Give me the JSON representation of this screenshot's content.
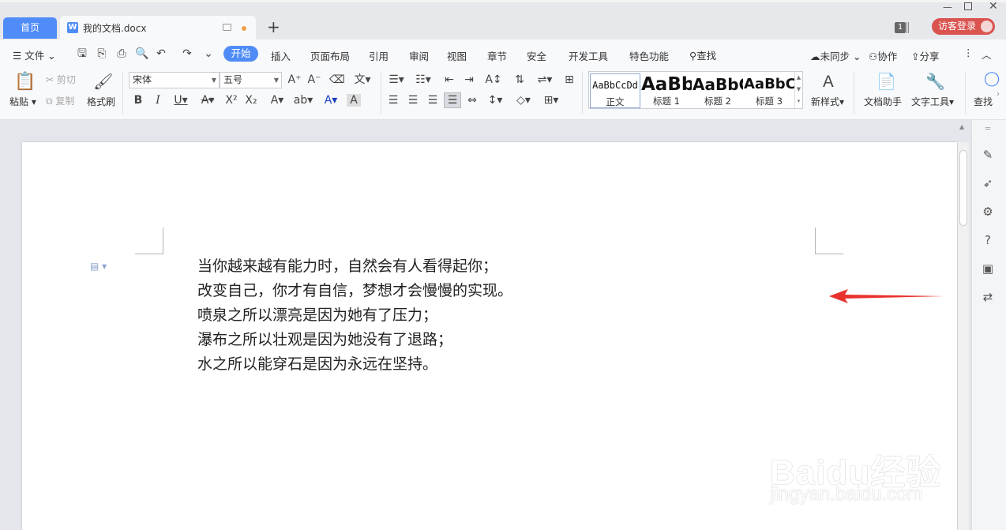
{
  "tabs": {
    "home": "首页",
    "doc": "我的文档.docx",
    "new_tab": "+"
  },
  "titlebar": {
    "badge": "1",
    "login": "访客登录"
  },
  "menu": {
    "file": "文件",
    "items": [
      "开始",
      "插入",
      "页面布局",
      "引用",
      "审阅",
      "视图",
      "章节",
      "安全",
      "开发工具",
      "特色功能"
    ],
    "search": "查找",
    "sync": "未同步",
    "collab": "协作",
    "share": "分享"
  },
  "ribbon": {
    "paste": "粘贴",
    "cut": "剪切",
    "copy": "复制",
    "format_painter": "格式刷",
    "font": "宋体",
    "size": "五号",
    "styles": [
      {
        "preview": "AaBbCcDd",
        "label": "正文"
      },
      {
        "preview": "AaBb",
        "label": "标题 1"
      },
      {
        "preview": "AaBbC",
        "label": "标题 2"
      },
      {
        "preview": "AaBbC",
        "label": "标题 3"
      }
    ],
    "new_style": "新样式",
    "doc_assistant": "文档助手",
    "text_tools": "文字工具",
    "find": "查找"
  },
  "document": {
    "lines": [
      "当你越来越有能力时，自然会有人看得起你；",
      "改变自己，你才有自信，梦想才会慢慢的实现。",
      "喷泉之所以漂亮是因为她有了压力；",
      "瀑布之所以壮观是因为她没有了退路；",
      "水之所以能穿石是因为永远在坚持。"
    ]
  },
  "watermark": {
    "brand": "Baidu经验",
    "url": "jingyan.baidu.com"
  },
  "colors": {
    "accent": "#4f8cf7",
    "login": "#d9534f",
    "arrow": "#e8322d"
  }
}
